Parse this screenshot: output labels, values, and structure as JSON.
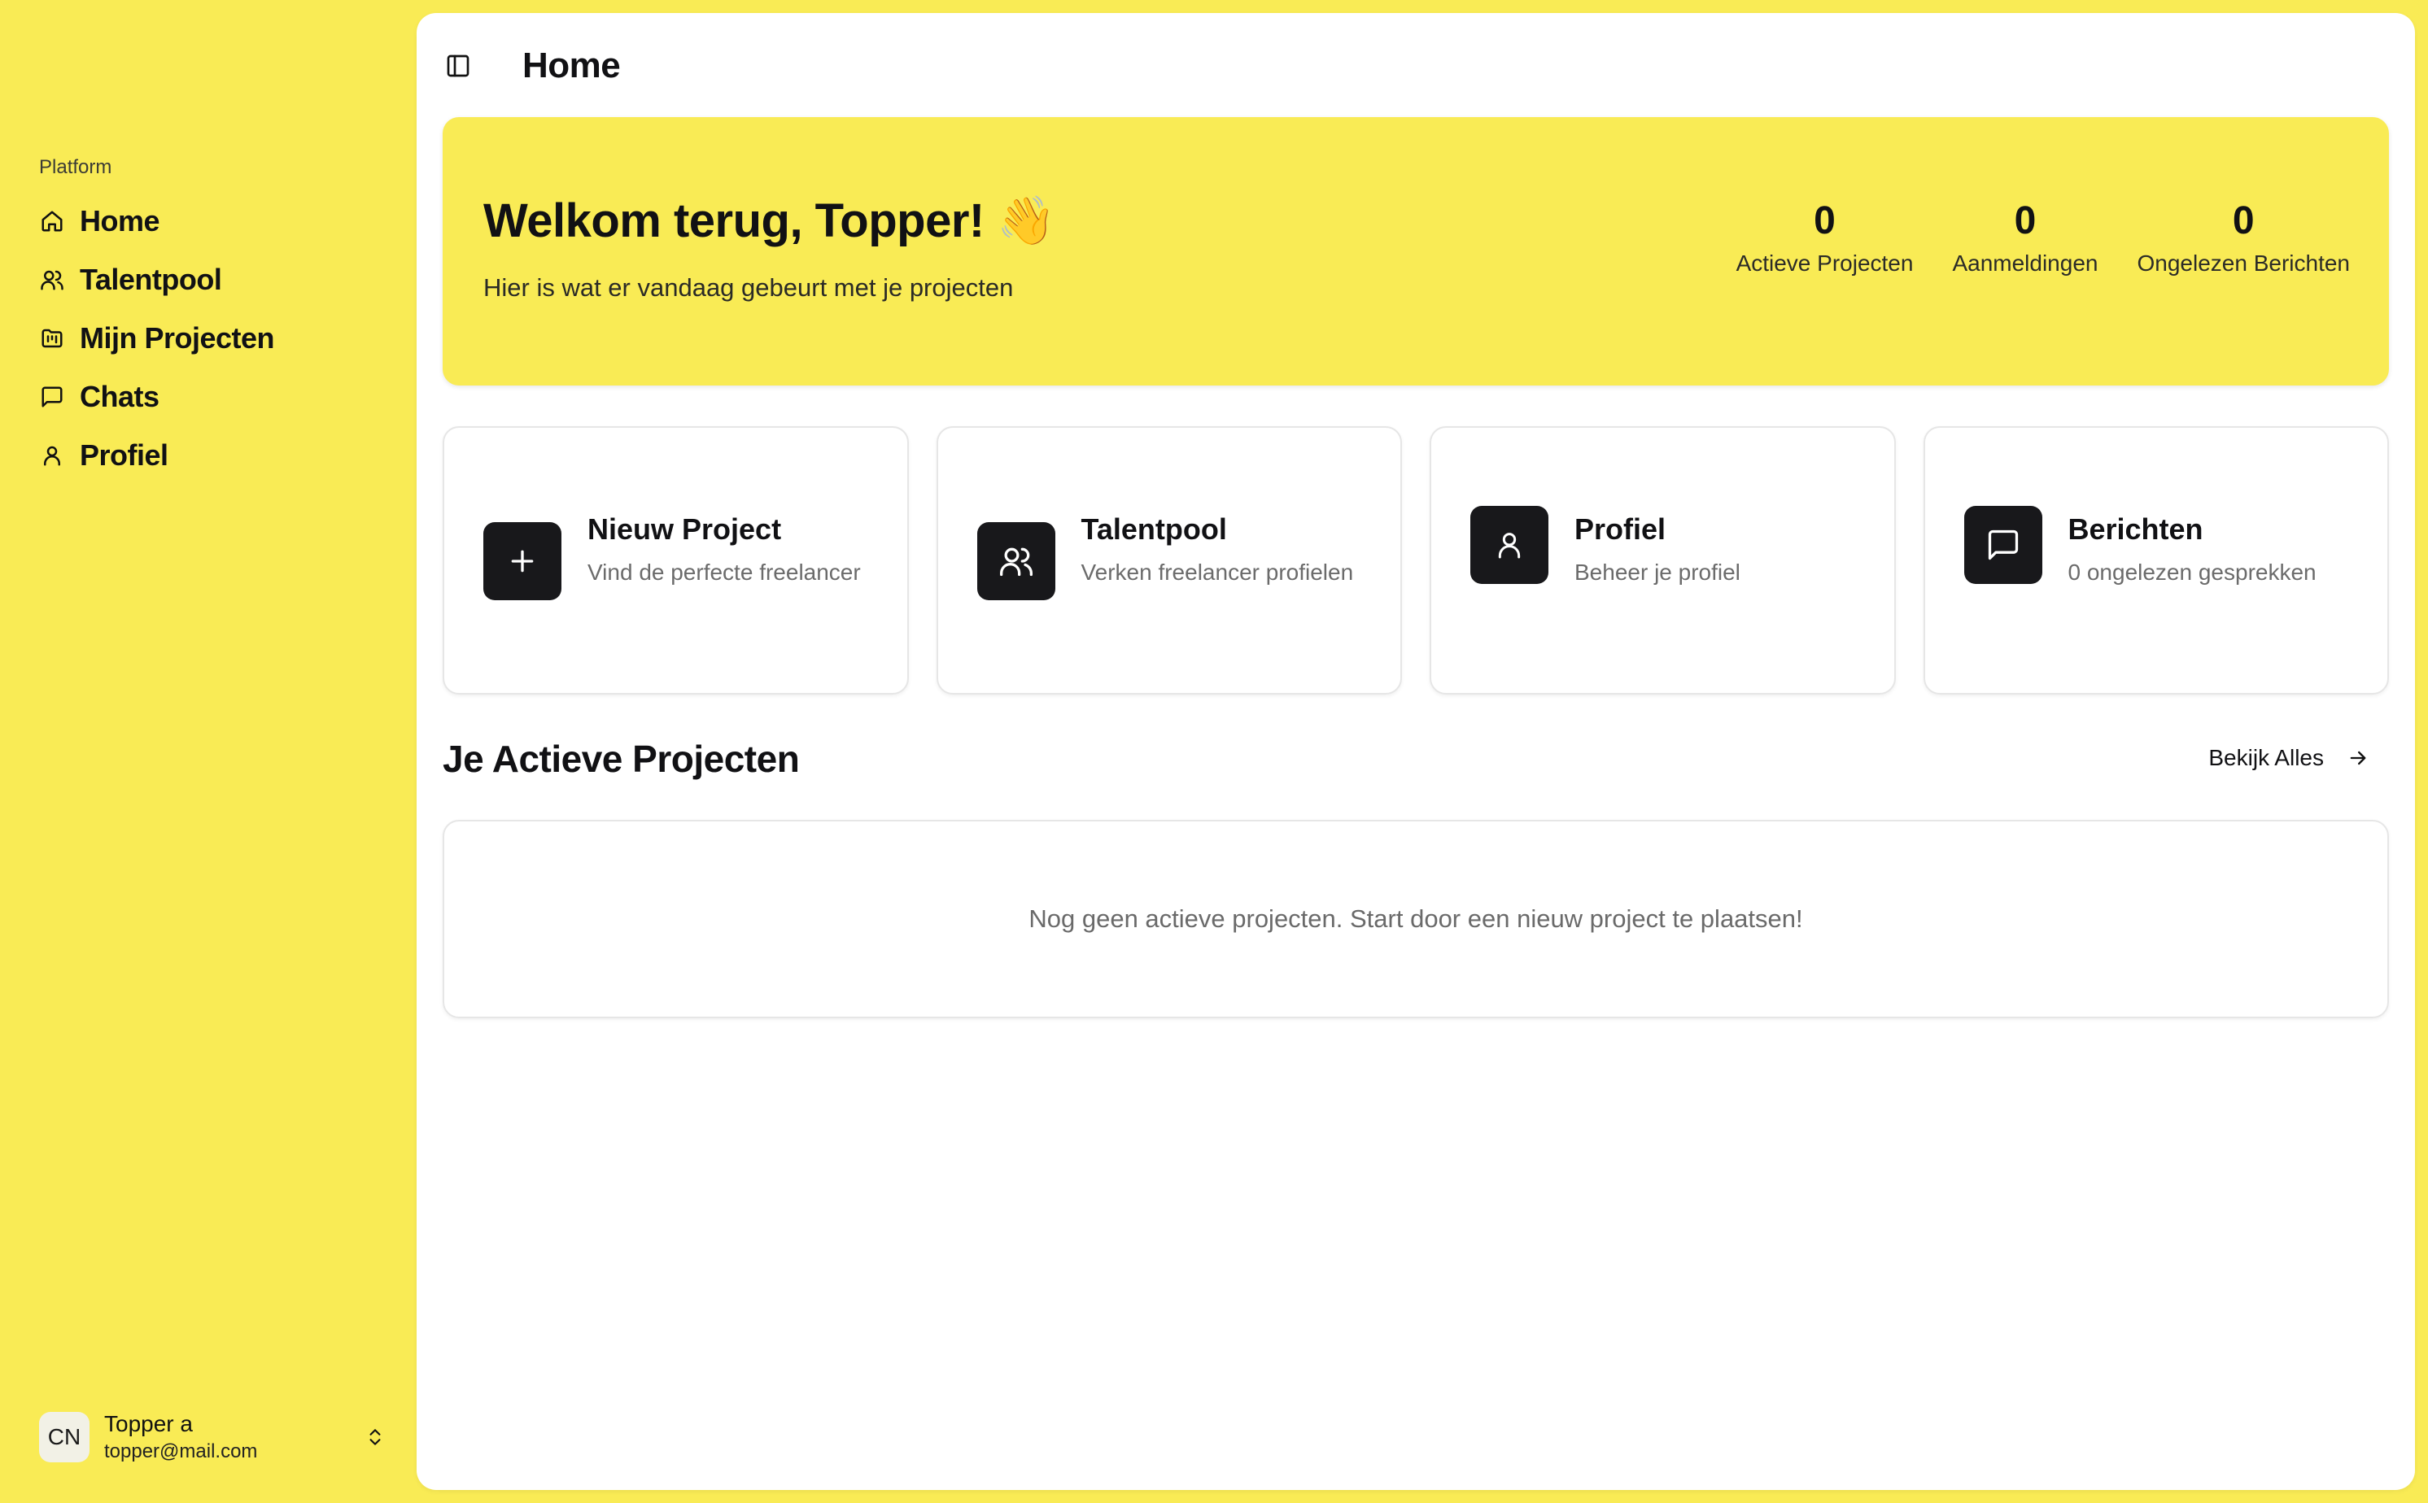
{
  "colors": {
    "accent": "#F9EB55",
    "icon_tile": "#18181b",
    "panel": "#ffffff",
    "muted_text": "#6b6b6b"
  },
  "sidebar": {
    "group_label": "Platform",
    "items": [
      {
        "label": "Home",
        "icon": "home-icon"
      },
      {
        "label": "Talentpool",
        "icon": "users-icon"
      },
      {
        "label": "Mijn Projecten",
        "icon": "folder-kanban-icon"
      },
      {
        "label": "Chats",
        "icon": "message-square-icon"
      },
      {
        "label": "Profiel",
        "icon": "user-icon"
      }
    ],
    "user": {
      "initials": "CN",
      "name": "Topper a",
      "email": "topper@mail.com"
    }
  },
  "header": {
    "title": "Home"
  },
  "hero": {
    "title": "Welkom terug, Topper! 👋",
    "subtitle": "Hier is wat er vandaag gebeurt met je projecten",
    "stats": [
      {
        "value": "0",
        "label": "Actieve Projecten"
      },
      {
        "value": "0",
        "label": "Aanmeldingen"
      },
      {
        "value": "0",
        "label": "Ongelezen Berichten"
      }
    ]
  },
  "quick_actions": [
    {
      "title": "Nieuw Project",
      "description": "Vind de perfecte freelancer",
      "icon": "plus-icon"
    },
    {
      "title": "Talentpool",
      "description": "Verken freelancer profielen",
      "icon": "users-icon"
    },
    {
      "title": "Profiel",
      "description": "Beheer je profiel",
      "icon": "user-icon"
    },
    {
      "title": "Berichten",
      "description": "0 ongelezen gesprekken",
      "icon": "message-square-icon"
    }
  ],
  "projects": {
    "title": "Je Actieve Projecten",
    "view_all_label": "Bekijk Alles",
    "empty_text": "Nog geen actieve projecten. Start door een nieuw project te plaatsen!"
  }
}
